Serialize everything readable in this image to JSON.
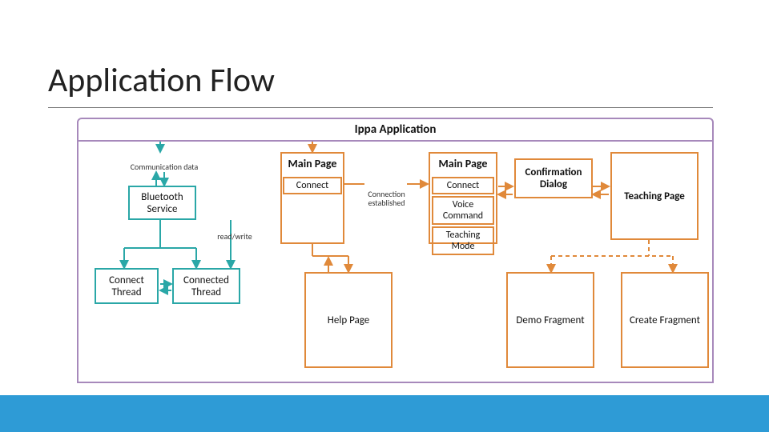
{
  "title": "Application Flow",
  "app_header": "Ippa Application",
  "labels": {
    "comm_data": "Communication data",
    "read_write": "read/write",
    "conn_est": "Connection established"
  },
  "nodes": {
    "bluetooth": "Bluetooth Service",
    "connect_thread": "Connect Thread",
    "connected_thread": "Connected Thread",
    "mainpage1": {
      "title": "Main Page",
      "connect": "Connect"
    },
    "mainpage2": {
      "title": "Main Page",
      "connect": "Connect",
      "voice": "Voice Command",
      "teach": "Teaching Mode"
    },
    "conf_dialog": "Confirmation Dialog",
    "teaching_page": "Teaching Page",
    "help_page": "Help Page",
    "demo_fragment": "Demo Fragment",
    "create_fragment": "Create Fragment"
  }
}
